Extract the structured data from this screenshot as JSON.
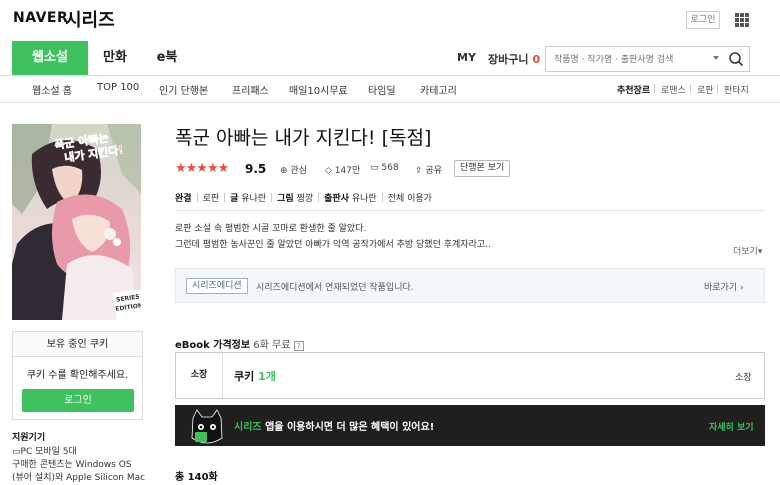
{
  "header": {
    "naver_logo": "NAVER",
    "series_logo": "시리즈",
    "login_label": "로그인",
    "apps_icon": "grid-icon"
  },
  "category_nav": {
    "tabs": [
      {
        "label": "웹소설",
        "active": true
      },
      {
        "label": "만화",
        "active": false
      },
      {
        "label": "e북",
        "active": false
      }
    ],
    "my_label": "MY",
    "cart_label": "장바구니",
    "cart_count": "0",
    "search_placeholder": "작품명 · 작가명 · 출판사명 검색"
  },
  "sub_nav": {
    "items": [
      "웹소설 홈",
      "TOP 100",
      "인기 단행본",
      "프리패스",
      "매일10시무료",
      "타임딜",
      "카테고리"
    ],
    "genres": [
      "추천장르",
      "로맨스",
      "로판",
      "판타지"
    ]
  },
  "cover": {
    "title_art": "폭군 아빠는 내가 지킨다!",
    "edition_badge": "SERIES EDITION"
  },
  "cookie_box": {
    "title": "보유 중인 쿠키",
    "message": "쿠키 수를 확인해주세요.",
    "login_button": "로그인"
  },
  "devices": {
    "title": "지원기기",
    "line1": "PC  모바일 5대",
    "line2": "구매한 콘텐츠는 Windows OS",
    "line3": "(뷰어 설치)와 Apple Silicon Mac"
  },
  "book": {
    "title": "폭군 아빠는 내가 지킨다! [독점]",
    "rating_stars": 4.75,
    "rating": "9.5",
    "interest_label": "관심",
    "views": "147만",
    "comments": "568",
    "share_label": "공유",
    "single_volume_button": "단행본 보기",
    "status": "완결",
    "genre": "로판",
    "writer_label": "글",
    "writer": "유나란",
    "illustrator_label": "그림",
    "illustrator": "찡깡",
    "publisher_label": "출판사",
    "publisher": "유나란",
    "age": "전체 이용가",
    "desc_line1": "로판 소설 속 평범한 시골 꼬마로 환생한 줄 알았다.",
    "desc_line2": "그런데 평범한 농사꾼인 줄 알았던 아빠가 악역 공작가에서 추방 당했던 후계자라고..",
    "more_label": "더보기"
  },
  "edition_bar": {
    "tag": "시리즈에디션",
    "text": "시리즈에디션에서 연재되었던 작품입니다.",
    "link": "바로가기"
  },
  "price": {
    "heading": "eBook 가격정보",
    "free_info": "6화 무료",
    "help": "?",
    "own_label": "소장",
    "cookie_label": "쿠키",
    "cookie_count": "1개",
    "own_right": "소장"
  },
  "promo": {
    "brand": "시리즈",
    "text": " 앱을 이용하시면 더 많은 혜택이 있어요!",
    "link": "자세히 보기"
  },
  "total_label": "총 140화"
}
